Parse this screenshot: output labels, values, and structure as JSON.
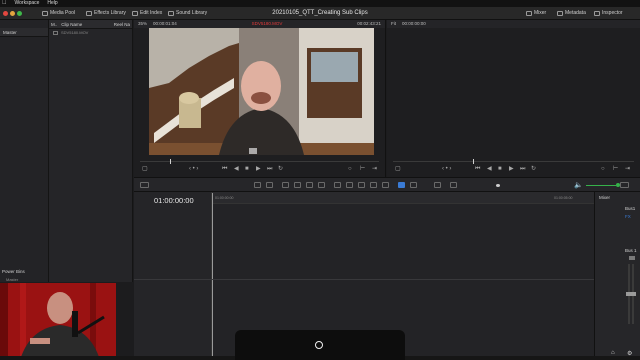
{
  "menubar": {
    "apple": "",
    "items": [
      "Workspace",
      "Help"
    ]
  },
  "toolbar": {
    "media_pool": "Media Pool",
    "effects_library": "Effects Library",
    "edit_index": "Edit Index",
    "sound_library": "Sound Library",
    "project_title": "20210105_QTT_Creating Sub Clips",
    "mixer": "Mixer",
    "metadata": "Metadata",
    "inspector": "Inspector"
  },
  "media_pool": {
    "left_header": "Master",
    "list_header_short": "M..",
    "clip_name_header": "Clip Name",
    "reel_header": "Reel Na",
    "clips": [
      "SDV5180.MOV"
    ],
    "power_bins": "Power Bins",
    "power_bins_master": "Master"
  },
  "source_viewer": {
    "zoom": "35%",
    "timecode_in": "00:00:01:04",
    "clip_name": "SDV5180.MOV",
    "duration": "00:02:43:21"
  },
  "record_viewer": {
    "fit": "Fit",
    "timecode": "00:00:00:00"
  },
  "timeline": {
    "timecode": "01:00:00:00",
    "ruler_start": "01:00:00:00",
    "ruler_end": "01:00:05:00"
  },
  "mixer": {
    "title": "Mixer",
    "bus1_top": "Bus1",
    "bus1": "Bus 1",
    "fx": "FX"
  },
  "colors": {
    "accent_red": "#e23b3b",
    "accent_blue": "#3a7bd5",
    "meter_green": "#36b24a"
  }
}
